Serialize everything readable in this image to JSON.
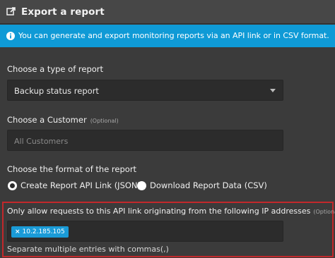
{
  "header": {
    "title": "Export a report",
    "icon": "export-icon"
  },
  "info": {
    "text": "You can generate and export monitoring reports via an API link or in CSV format.",
    "icon": "info-icon"
  },
  "report_type": {
    "label": "Choose a type of report",
    "selected": "Backup status report"
  },
  "customer": {
    "label": "Choose a Customer",
    "optional": "(Optional)",
    "placeholder": "All Customers"
  },
  "format": {
    "label": "Choose the format of the report",
    "options": [
      {
        "label": "Create Report API Link (JSON)",
        "checked": true
      },
      {
        "label": "Download Report Data (CSV)",
        "checked": false
      }
    ]
  },
  "ip_filter": {
    "label": "Only allow requests to this API link originating from the following IP addresses",
    "optional": "(Optional)",
    "tags": [
      {
        "remove": "×",
        "value": "10.2.185.105"
      }
    ],
    "help": "Separate multiple entries with commas(,)"
  },
  "colors": {
    "background": "#3b3b3b",
    "header": "#474747",
    "info": "#0f9ad6",
    "tag": "#1a9bd7",
    "highlight_border": "#c2282b"
  }
}
